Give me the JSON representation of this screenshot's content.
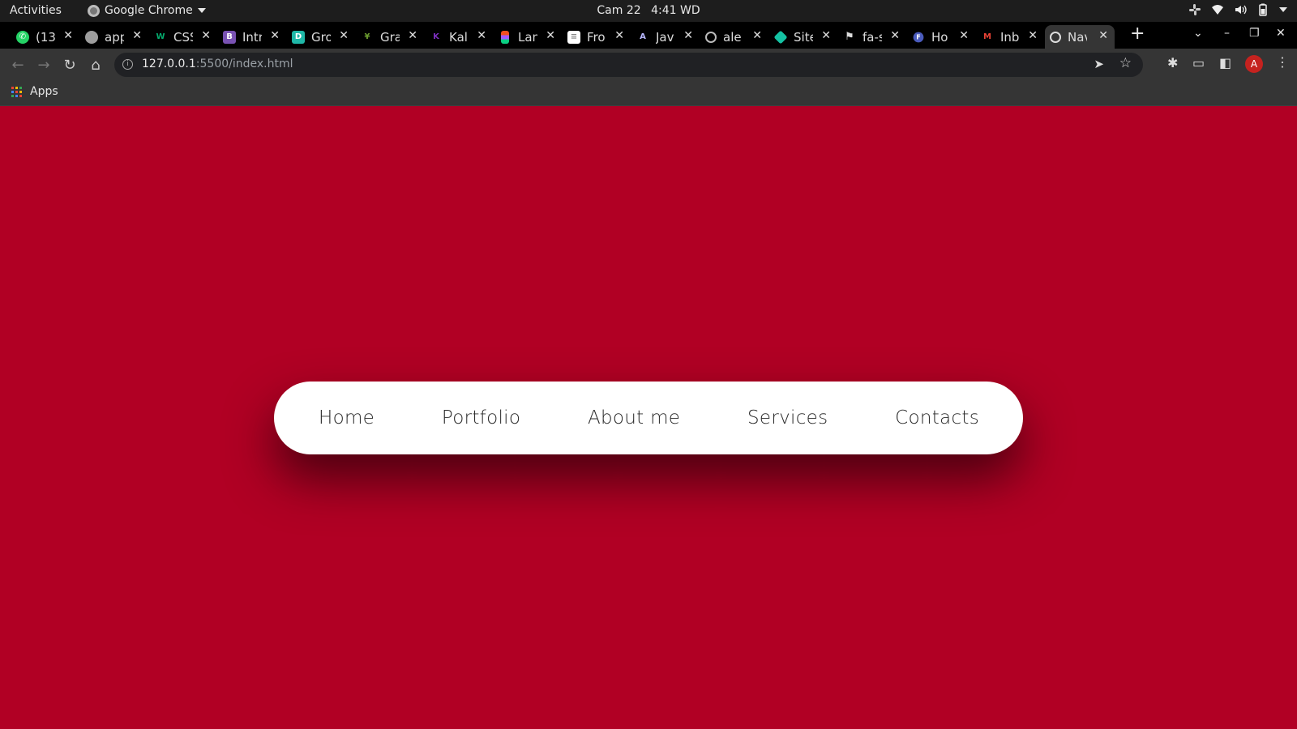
{
  "os_bar": {
    "activities": "Activities",
    "app_name": "Google Chrome",
    "date": "Cam 22",
    "time": "4:41 WD"
  },
  "tabs": [
    {
      "title": "(13",
      "favicon_color": "#25d366",
      "favicon_text": "☎"
    },
    {
      "title": "app",
      "favicon_color": "#9e9e9e",
      "favicon_text": "●"
    },
    {
      "title": "CSS",
      "favicon_color": "#000000",
      "favicon_text": "W"
    },
    {
      "title": "Intr",
      "favicon_color": "#7952b3",
      "favicon_text": "B"
    },
    {
      "title": "Gro",
      "favicon_color": "#1fb8a8",
      "favicon_text": "D"
    },
    {
      "title": "Gra",
      "favicon_color": "#000000",
      "favicon_text": "🌴"
    },
    {
      "title": "Kal",
      "favicon_color": "#000000",
      "favicon_text": "K"
    },
    {
      "title": "Lan",
      "favicon_color": "#000000",
      "favicon_text": "F"
    },
    {
      "title": "Fro",
      "favicon_color": "#ffffff",
      "favicon_text": "∴"
    },
    {
      "title": "Jav",
      "favicon_color": "#000000",
      "favicon_text": "A"
    },
    {
      "title": "ale",
      "favicon_color": "#000000",
      "favicon_text": "◯"
    },
    {
      "title": "Site",
      "favicon_color": "#000000",
      "favicon_text": "◆"
    },
    {
      "title": "fa-s",
      "favicon_color": "#000000",
      "favicon_text": "⚑"
    },
    {
      "title": "Ho",
      "favicon_color": "#4a5bbd",
      "favicon_text": "F"
    },
    {
      "title": "Inb",
      "favicon_color": "#000000",
      "favicon_text": "M"
    },
    {
      "title": "Nav",
      "favicon_color": "#353535",
      "favicon_text": "🌐",
      "active": true
    }
  ],
  "toolbar": {
    "url_host": "127.0.0.1",
    "url_rest": ":5500/index.html",
    "profile_initial": "A"
  },
  "bookmarks": {
    "apps_label": "Apps"
  },
  "page": {
    "background": "#b10024",
    "nav": {
      "home": "Home",
      "portfolio": "Portfolio",
      "about": "About me",
      "services": "Services",
      "contacts": "Contacts"
    }
  }
}
